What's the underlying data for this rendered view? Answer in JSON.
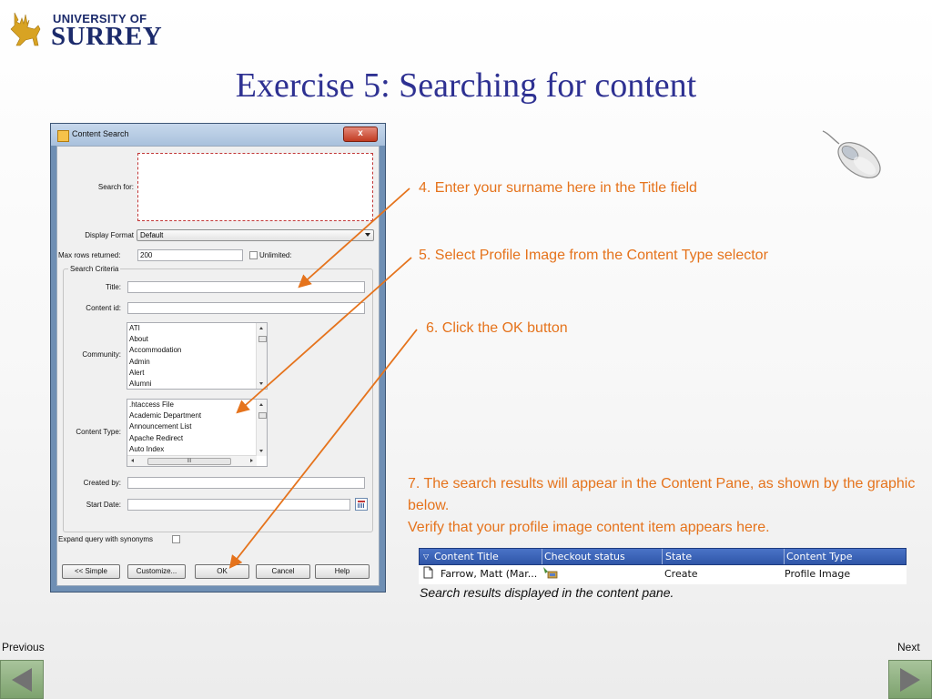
{
  "logo": {
    "line1": "UNIVERSITY OF",
    "line2": "SURREY"
  },
  "slide_title": "Exercise 5: Searching for content",
  "dialog": {
    "title": "Content Search",
    "close_glyph": "x",
    "search_for_label": "Search for:",
    "display_format_label": "Display Format",
    "display_format_value": "Default",
    "max_rows_label": "Max rows returned:",
    "max_rows_value": "200",
    "unlimited_label": "Unlimited:",
    "criteria_legend": "Search Criteria",
    "title_label": "Title:",
    "content_id_label": "Content id:",
    "community_label": "Community:",
    "community_items": [
      "ATI",
      "About",
      "Accommodation",
      "Admin",
      "Alert",
      "Alumni"
    ],
    "content_type_label": "Content Type:",
    "content_type_items": [
      ".htaccess File",
      "Academic Department",
      "Announcement List",
      "Apache Redirect",
      "Auto Index"
    ],
    "hscroll_glyph": "III",
    "created_by_label": "Created by:",
    "start_date_label": "Start Date:",
    "expand_label": "Expand query with synonyms",
    "buttons": {
      "simple": "<< Simple",
      "customize": "Customize...",
      "ok": "OK",
      "cancel": "Cancel",
      "help": "Help"
    }
  },
  "instructions": {
    "step4": "4. Enter your surname here in the Title field",
    "step5": "5. Select Profile Image from the Content Type selector",
    "step6": "6. Click the OK button",
    "step7": "7. The search results will appear in the Content Pane, as shown by the graphic below.",
    "step7b": "Verify that your profile image content item appears here."
  },
  "results": {
    "headers": [
      "Content Title",
      "Checkout status",
      "State",
      "Content Type"
    ],
    "row": {
      "title": "Farrow, Matt (Mar...",
      "state": "Create",
      "type": "Profile Image"
    },
    "caption": "Search results displayed in the content pane."
  },
  "nav": {
    "previous": "Previous",
    "next": "Next"
  },
  "colors": {
    "accent": "#e5731c",
    "title": "#2e3192",
    "nav": "#8db17f"
  }
}
